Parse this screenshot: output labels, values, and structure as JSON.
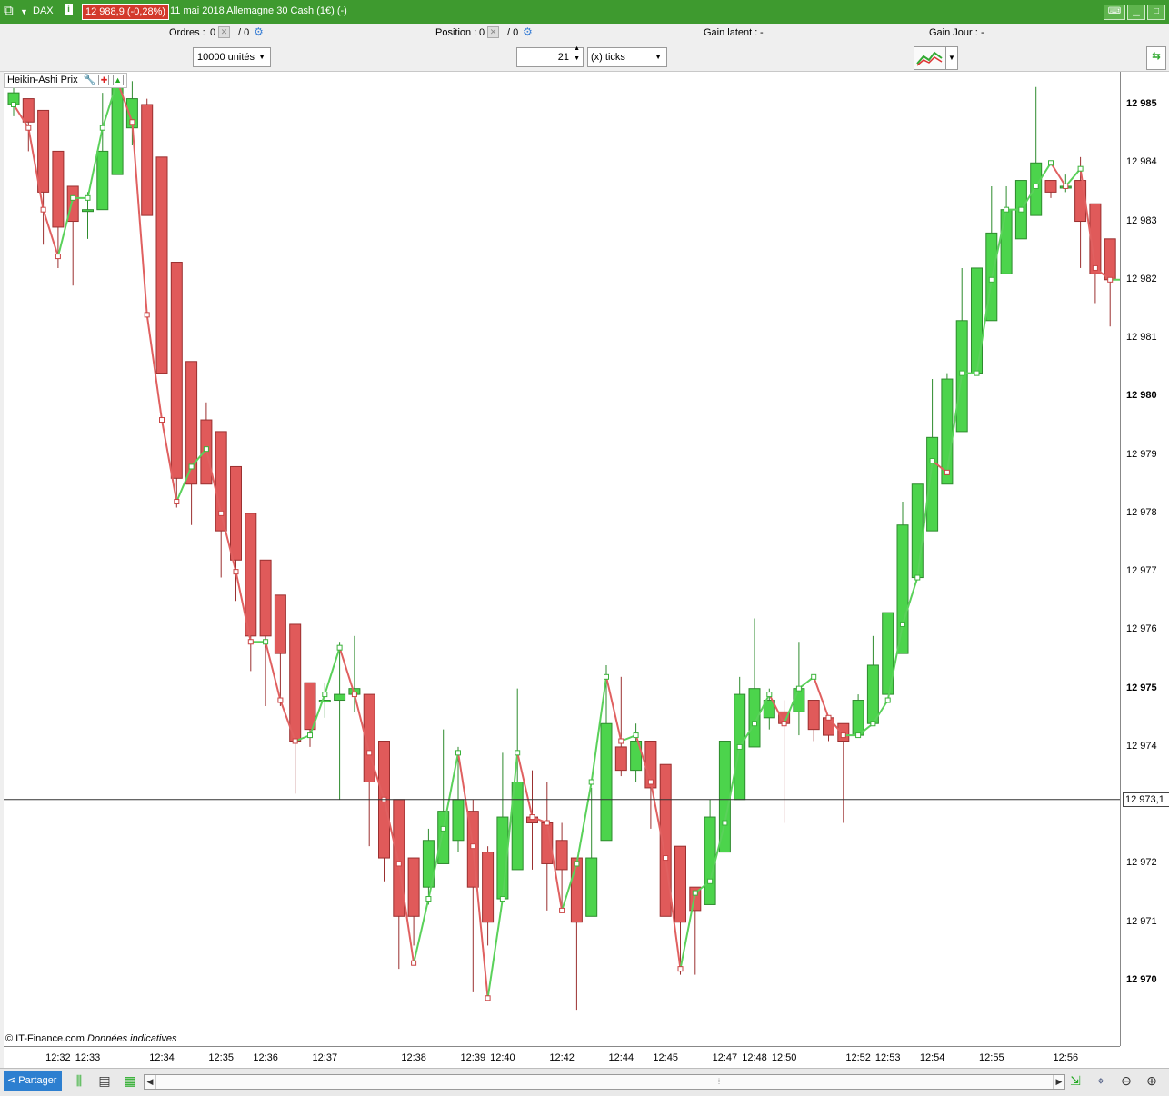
{
  "titlebar": {
    "instrument": "DAX",
    "price_badge": "12 988,9 (-0,28%)",
    "title": "11 mai 2018  Allemagne 30 Cash (1€) (-)",
    "info_icon": "info-icon",
    "colors": {
      "bar": "#3e9a2f",
      "badge": "#d33a2c"
    }
  },
  "toolbar1": {
    "orders_label": "Ordres :",
    "orders_value1": "0",
    "orders_value2": "/  0",
    "position_label": "Position :",
    "position_value1": "0",
    "position_value2": "/  0",
    "gain_latent_label": "Gain latent :",
    "gain_latent_value": "-",
    "gain_jour_label": "Gain Jour :",
    "gain_jour_value": "-"
  },
  "toolbar2": {
    "units_select": "10000 unités",
    "ticks_value": "21",
    "ticks_unit_select": "(x) ticks"
  },
  "indicator_label": "Heikin-Ashi Prix",
  "copyright": "© IT-Finance.com",
  "copyright_note": "Données indicatives",
  "current_price_label": "12 973,1",
  "price_axis_labels": [
    {
      "text": "12 985",
      "value": 12985,
      "major": true
    },
    {
      "text": "12 984",
      "value": 12984,
      "major": false
    },
    {
      "text": "12 983",
      "value": 12983,
      "major": false
    },
    {
      "text": "12 982",
      "value": 12982,
      "major": false
    },
    {
      "text": "12 981",
      "value": 12981,
      "major": false
    },
    {
      "text": "12 980",
      "value": 12980,
      "major": true
    },
    {
      "text": "12 979",
      "value": 12979,
      "major": false
    },
    {
      "text": "12 978",
      "value": 12978,
      "major": false
    },
    {
      "text": "12 977",
      "value": 12977,
      "major": false
    },
    {
      "text": "12 976",
      "value": 12976,
      "major": false
    },
    {
      "text": "12 975",
      "value": 12975,
      "major": true
    },
    {
      "text": "12 974",
      "value": 12974,
      "major": false
    },
    {
      "text": "12 972",
      "value": 12972,
      "major": false
    },
    {
      "text": "12 971",
      "value": 12971,
      "major": false
    },
    {
      "text": "12 970",
      "value": 12970,
      "major": true
    }
  ],
  "time_axis_labels": [
    {
      "text": "12:32",
      "bar": 3
    },
    {
      "text": "12:33",
      "bar": 5
    },
    {
      "text": "12:34",
      "bar": 10
    },
    {
      "text": "12:35",
      "bar": 14
    },
    {
      "text": "12:36",
      "bar": 17
    },
    {
      "text": "12:37",
      "bar": 21
    },
    {
      "text": "12:38",
      "bar": 27
    },
    {
      "text": "12:39",
      "bar": 31
    },
    {
      "text": "12:40",
      "bar": 33
    },
    {
      "text": "12:42",
      "bar": 37
    },
    {
      "text": "12:44",
      "bar": 41
    },
    {
      "text": "12:45",
      "bar": 44
    },
    {
      "text": "12:47",
      "bar": 48
    },
    {
      "text": "12:48",
      "bar": 50
    },
    {
      "text": "12:50",
      "bar": 52
    },
    {
      "text": "12:52",
      "bar": 57
    },
    {
      "text": "12:53",
      "bar": 59
    },
    {
      "text": "12:54",
      "bar": 62
    },
    {
      "text": "12:55",
      "bar": 66
    },
    {
      "text": "12:56",
      "bar": 71
    }
  ],
  "bottombar": {
    "share_label": "Partager"
  },
  "chart_data": {
    "type": "candlestick",
    "title": "Heikin-Ashi Prix",
    "ylim": [
      12969.5,
      12985.4
    ],
    "current_price": 12973.1,
    "colors": {
      "up": "#4cd44c",
      "down": "#e05a5a",
      "up_line": "#5ad15a",
      "down_line": "#e06060",
      "crosshair": "#333333"
    },
    "candles": [
      {
        "o": 12985.0,
        "c": 12985.2,
        "h": 12985.4,
        "l": 12984.8
      },
      {
        "o": 12985.1,
        "c": 12984.7,
        "h": 12985.1,
        "l": 12984.2
      },
      {
        "o": 12984.9,
        "c": 12983.5,
        "h": 12984.9,
        "l": 12982.6
      },
      {
        "o": 12984.2,
        "c": 12982.9,
        "h": 12984.2,
        "l": 12982.2
      },
      {
        "o": 12983.6,
        "c": 12983.0,
        "h": 12983.6,
        "l": 12981.9
      },
      {
        "o": 12983.2,
        "c": 12983.2,
        "h": 12983.5,
        "l": 12982.7
      },
      {
        "o": 12983.2,
        "c": 12984.2,
        "h": 12985.2,
        "l": 12983.2
      },
      {
        "o": 12983.8,
        "c": 12985.3,
        "h": 12985.4,
        "l": 12983.8
      },
      {
        "o": 12984.6,
        "c": 12985.1,
        "h": 12985.4,
        "l": 12984.3
      },
      {
        "o": 12985.0,
        "c": 12983.1,
        "h": 12985.1,
        "l": 12983.1
      },
      {
        "o": 12984.1,
        "c": 12980.4,
        "h": 12984.1,
        "l": 12980.4
      },
      {
        "o": 12982.3,
        "c": 12978.6,
        "h": 12982.3,
        "l": 12978.1
      },
      {
        "o": 12980.6,
        "c": 12978.5,
        "h": 12980.6,
        "l": 12977.8
      },
      {
        "o": 12979.6,
        "c": 12978.5,
        "h": 12979.9,
        "l": 12978.5
      },
      {
        "o": 12979.4,
        "c": 12977.7,
        "h": 12979.4,
        "l": 12976.9
      },
      {
        "o": 12978.8,
        "c": 12977.2,
        "h": 12978.8,
        "l": 12976.5
      },
      {
        "o": 12978.0,
        "c": 12975.9,
        "h": 12978.0,
        "l": 12975.3
      },
      {
        "o": 12977.2,
        "c": 12975.9,
        "h": 12977.2,
        "l": 12974.7
      },
      {
        "o": 12976.6,
        "c": 12975.6,
        "h": 12976.6,
        "l": 12974.7
      },
      {
        "o": 12976.1,
        "c": 12974.1,
        "h": 12976.1,
        "l": 12973.2
      },
      {
        "o": 12975.1,
        "c": 12974.3,
        "h": 12975.1,
        "l": 12974.0
      },
      {
        "o": 12974.8,
        "c": 12974.8,
        "h": 12975.1,
        "l": 12974.5
      },
      {
        "o": 12974.8,
        "c": 12974.9,
        "h": 12975.8,
        "l": 12973.1
      },
      {
        "o": 12974.9,
        "c": 12975.0,
        "h": 12975.9,
        "l": 12974.6
      },
      {
        "o": 12974.9,
        "c": 12973.4,
        "h": 12974.9,
        "l": 12972.3
      },
      {
        "o": 12974.1,
        "c": 12972.1,
        "h": 12974.1,
        "l": 12971.7
      },
      {
        "o": 12973.1,
        "c": 12971.1,
        "h": 12973.1,
        "l": 12970.2
      },
      {
        "o": 12972.1,
        "c": 12971.1,
        "h": 12972.1,
        "l": 12970.6
      },
      {
        "o": 12971.6,
        "c": 12972.4,
        "h": 12972.6,
        "l": 12971.3
      },
      {
        "o": 12972.0,
        "c": 12972.9,
        "h": 12974.3,
        "l": 12972.0
      },
      {
        "o": 12972.4,
        "c": 12973.1,
        "h": 12974.0,
        "l": 12972.2
      },
      {
        "o": 12972.9,
        "c": 12971.6,
        "h": 12973.1,
        "l": 12969.8
      },
      {
        "o": 12972.2,
        "c": 12971.0,
        "h": 12972.3,
        "l": 12970.6
      },
      {
        "o": 12971.4,
        "c": 12972.8,
        "h": 12973.9,
        "l": 12971.4
      },
      {
        "o": 12971.9,
        "c": 12973.4,
        "h": 12975.0,
        "l": 12971.9
      },
      {
        "o": 12972.8,
        "c": 12972.7,
        "h": 12973.6,
        "l": 12971.9
      },
      {
        "o": 12972.7,
        "c": 12972.0,
        "h": 12973.4,
        "l": 12971.2
      },
      {
        "o": 12972.4,
        "c": 12971.9,
        "h": 12972.7,
        "l": 12971.2
      },
      {
        "o": 12972.1,
        "c": 12971.0,
        "h": 12972.1,
        "l": 12969.5
      },
      {
        "o": 12971.1,
        "c": 12972.1,
        "h": 12973.3,
        "l": 12971.1
      },
      {
        "o": 12972.4,
        "c": 12974.4,
        "h": 12975.4,
        "l": 12972.4
      },
      {
        "o": 12974.0,
        "c": 12973.6,
        "h": 12975.2,
        "l": 12973.5
      },
      {
        "o": 12973.6,
        "c": 12974.1,
        "h": 12974.4,
        "l": 12973.4
      },
      {
        "o": 12974.1,
        "c": 12973.3,
        "h": 12974.1,
        "l": 12972.6
      },
      {
        "o": 12973.7,
        "c": 12971.1,
        "h": 12973.7,
        "l": 12971.1
      },
      {
        "o": 12972.3,
        "c": 12971.0,
        "h": 12972.3,
        "l": 12970.1
      },
      {
        "o": 12971.6,
        "c": 12971.2,
        "h": 12971.6,
        "l": 12970.1
      },
      {
        "o": 12971.3,
        "c": 12972.8,
        "h": 12973.1,
        "l": 12971.3
      },
      {
        "o": 12972.2,
        "c": 12974.1,
        "h": 12974.1,
        "l": 12972.2
      },
      {
        "o": 12973.1,
        "c": 12974.9,
        "h": 12975.2,
        "l": 12973.1
      },
      {
        "o": 12974.0,
        "c": 12975.0,
        "h": 12976.2,
        "l": 12974.0
      },
      {
        "o": 12974.5,
        "c": 12974.8,
        "h": 12975.0,
        "l": 12974.3
      },
      {
        "o": 12974.6,
        "c": 12974.4,
        "h": 12974.8,
        "l": 12972.7
      },
      {
        "o": 12974.6,
        "c": 12975.0,
        "h": 12975.8,
        "l": 12974.2
      },
      {
        "o": 12974.8,
        "c": 12974.3,
        "h": 12974.8,
        "l": 12974.1
      },
      {
        "o": 12974.5,
        "c": 12974.2,
        "h": 12974.5,
        "l": 12974.1
      },
      {
        "o": 12974.4,
        "c": 12974.1,
        "h": 12974.4,
        "l": 12972.7
      },
      {
        "o": 12974.2,
        "c": 12974.8,
        "h": 12974.9,
        "l": 12974.2
      },
      {
        "o": 12974.4,
        "c": 12975.4,
        "h": 12975.9,
        "l": 12974.4
      },
      {
        "o": 12974.9,
        "c": 12976.3,
        "h": 12976.3,
        "l": 12974.9
      },
      {
        "o": 12975.6,
        "c": 12977.8,
        "h": 12978.2,
        "l": 12975.6
      },
      {
        "o": 12976.9,
        "c": 12978.5,
        "h": 12978.5,
        "l": 12976.9
      },
      {
        "o": 12977.7,
        "c": 12979.3,
        "h": 12980.3,
        "l": 12977.7
      },
      {
        "o": 12978.5,
        "c": 12980.3,
        "h": 12980.4,
        "l": 12978.5
      },
      {
        "o": 12979.4,
        "c": 12981.3,
        "h": 12982.2,
        "l": 12979.4
      },
      {
        "o": 12980.4,
        "c": 12982.2,
        "h": 12982.2,
        "l": 12980.4
      },
      {
        "o": 12981.3,
        "c": 12982.8,
        "h": 12983.6,
        "l": 12981.3
      },
      {
        "o": 12982.1,
        "c": 12983.2,
        "h": 12983.6,
        "l": 12982.1
      },
      {
        "o": 12982.7,
        "c": 12983.7,
        "h": 12983.7,
        "l": 12982.7
      },
      {
        "o": 12983.1,
        "c": 12984.0,
        "h": 12985.3,
        "l": 12983.1
      },
      {
        "o": 12983.7,
        "c": 12983.5,
        "h": 12983.7,
        "l": 12983.4
      },
      {
        "o": 12983.6,
        "c": 12983.6,
        "h": 12983.8,
        "l": 12983.5
      },
      {
        "o": 12983.7,
        "c": 12983.0,
        "h": 12984.1,
        "l": 12982.2
      },
      {
        "o": 12983.3,
        "c": 12982.1,
        "h": 12983.3,
        "l": 12981.6
      },
      {
        "o": 12982.7,
        "c": 12982.0,
        "h": 12982.7,
        "l": 12981.2
      }
    ],
    "line_closes": [
      12985.0,
      12984.6,
      12983.2,
      12982.4,
      12983.4,
      12983.4,
      12984.6,
      12985.4,
      12984.7,
      12981.4,
      12979.6,
      12978.2,
      12978.8,
      12979.1,
      12978.0,
      12977.0,
      12975.8,
      12975.8,
      12974.8,
      12974.1,
      12974.2,
      12974.9,
      12975.7,
      12974.9,
      12973.9,
      12973.1,
      12972.0,
      12970.3,
      12971.4,
      12972.6,
      12973.9,
      12972.3,
      12969.7,
      12971.4,
      12973.9,
      12972.8,
      12972.7,
      12971.2,
      12972.0,
      12973.4,
      12975.2,
      12974.1,
      12974.2,
      12973.4,
      12972.1,
      12970.2,
      12971.5,
      12971.7,
      12972.7,
      12974.0,
      12974.4,
      12974.9,
      12974.4,
      12975.0,
      12975.2,
      12974.5,
      12974.2,
      12974.2,
      12974.4,
      12974.8,
      12976.1,
      12976.9,
      12978.9,
      12978.7,
      12980.4,
      12980.4,
      12982.0,
      12983.2,
      12983.2,
      12983.6,
      12984.0,
      12983.6,
      12983.9,
      12982.2,
      12982.0,
      12982.0
    ]
  }
}
